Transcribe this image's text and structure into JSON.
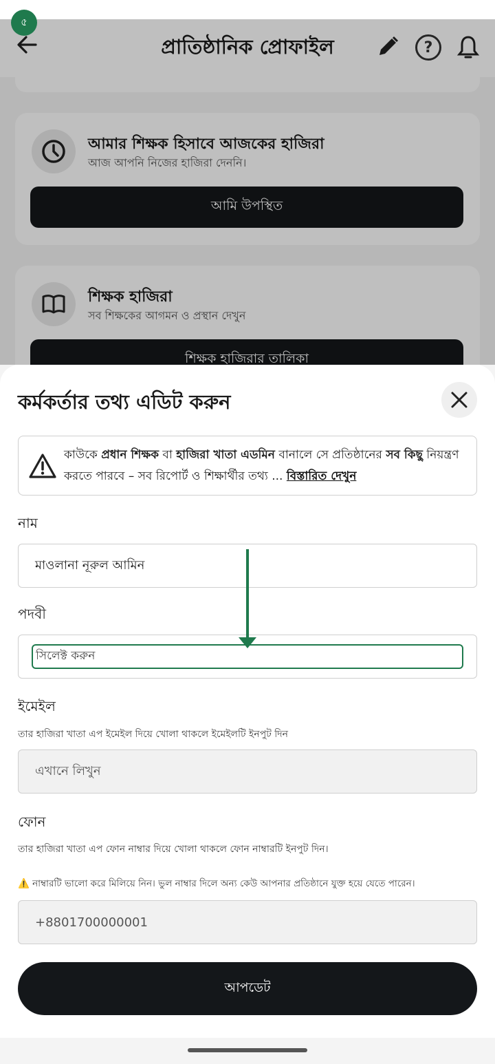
{
  "status": {
    "badge": "৫"
  },
  "app_bar": {
    "title": "প্রাতিষ্ঠানিক প্রোফাইল",
    "help_glyph": "?"
  },
  "cards": [
    {
      "title": "আমার শিক্ষক হিসাবে আজকের হাজিরা",
      "subtitle": "আজ আপনি নিজের হাজিরা দেননি।",
      "button": "আমি উপস্থিত",
      "icon": "clock-icon"
    },
    {
      "title": "শিক্ষক হাজিরা",
      "subtitle": "সব শিক্ষকের আগমন ও প্রস্থান দেখুন",
      "button": "শিক্ষক হাজিরার তালিকা",
      "icon": "book-icon"
    }
  ],
  "sheet": {
    "title": "কর্মকর্তার তথ্য এডিট করুন",
    "warning": {
      "p1": "কাউকে ",
      "b1": "প্রধান শিক্ষক",
      "p2": " বা ",
      "b2": "হাজিরা খাতা এডমিন",
      "p3": " বানালে সে প্রতিষ্ঠানের ",
      "b3": "সব কিছু",
      "p4": " নিয়ন্ত্রণ করতে পারবে – সব রিপোর্ট ও শিক্ষার্থীর তথ্য ... ",
      "link": "বিস্তারিত দেখুন"
    },
    "name": {
      "label": "নাম",
      "value": "মাওলানা নূরুল আমিন"
    },
    "designation": {
      "label": "পদবী",
      "placeholder": "সিলেক্ট করুন"
    },
    "email": {
      "label": "ইমেইল",
      "hint": "তার হাজিরা খাতা এপ ইমেইল দিয়ে খোলা থাকলে ইমেইলটি ইনপুট দিন",
      "placeholder": "এখানে লিখুন"
    },
    "phone": {
      "label": "ফোন",
      "hint": "তার হাজিরা খাতা এপ ফোন নাম্বার দিয়ে খোলা থাকলে ফোন নাম্বারটি ইনপুট দিন।",
      "warning": "⚠️ নাম্বারটি ভালো করে মিলিয়ে নিন। ভুল নাম্বার দিলে অন্য কেউ আপনার প্রতিষ্ঠানে যুক্ত হয়ে যেতে পারেন।",
      "value": "+8801700000001"
    },
    "update_button": "আপডেট"
  },
  "colors": {
    "accent": "#1f7a4d",
    "dark_button": "#14171a"
  }
}
